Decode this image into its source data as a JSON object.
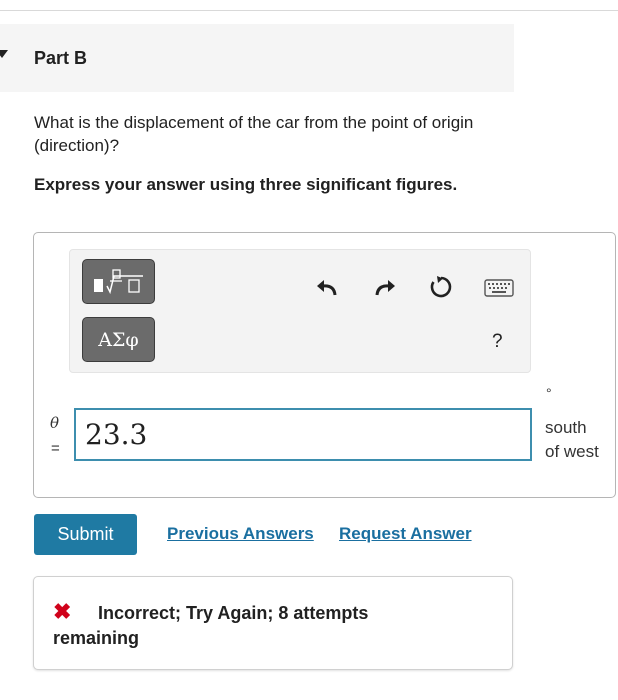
{
  "part": {
    "title": "Part B"
  },
  "question": {
    "text": "What is the displacement of the car from the point of origin (direction)?"
  },
  "instruction": {
    "text": "Express your answer using three significant figures."
  },
  "toolbar": {
    "symbols_label": "ΑΣφ",
    "help_label": "?",
    "icons": [
      "templates-icon",
      "undo-icon",
      "redo-icon",
      "reset-icon",
      "keyboard-icon"
    ]
  },
  "answer": {
    "variable": "θ",
    "equals": "=",
    "value": "23.3",
    "degree_symbol": "°",
    "unit": "south of west"
  },
  "actions": {
    "submit_label": "Submit",
    "previous_answers_label": "Previous Answers",
    "request_answer_label": "Request Answer"
  },
  "feedback": {
    "message": "Incorrect; Try Again; 8 attempts remaining",
    "status_color": "#d0021b"
  },
  "colors": {
    "accent": "#1f7aa3",
    "link": "#1a6fa0",
    "input_border": "#3d8eae"
  }
}
